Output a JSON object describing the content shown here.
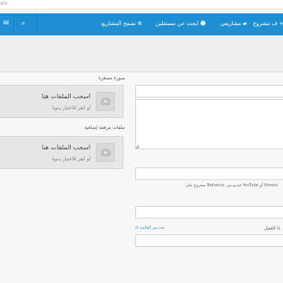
{
  "top_strip": {
    "crumb": "ate"
  },
  "navbar": {
    "items": [
      {
        "label": "ف مشروع",
        "icon": "plus-icon"
      },
      {
        "label": "مشاريعي",
        "icon": "folder-icon"
      },
      {
        "label": "ابحث عن مستقلين",
        "icon": "users-icon"
      },
      {
        "label": "تصفح المشاريع",
        "icon": "gear-icon"
      }
    ],
    "search_icon": "search-icon",
    "messages_icon": "envelope-icon",
    "color": "#1f8fd3"
  },
  "form": {
    "thumbnail_label": "صورة مصغرة",
    "thumbnail_drop": {
      "title": "اسحب الملفات هنا",
      "subtitle": "أو انقر للاختيار يدويا"
    },
    "attachments_label": "ملفات مرفقة إضافية",
    "attachments_drop": {
      "title": "اسحب الملفات هنا",
      "subtitle": "أو انقر للاختيار يدويا"
    },
    "video_hint": "مشروع على Behance، فيديو من YouTube أو Vimeo)",
    "select_link": "حدد من القائمة",
    "work_label": "ذا العمل"
  }
}
